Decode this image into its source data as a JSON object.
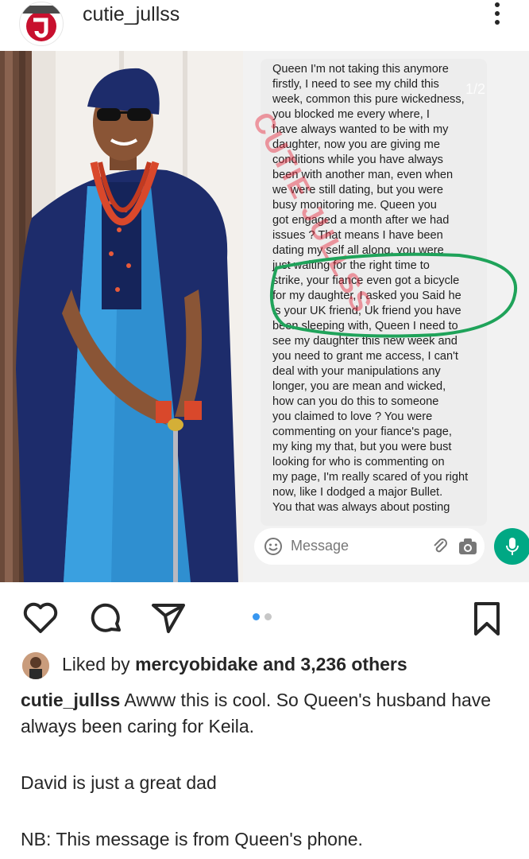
{
  "header": {
    "username": "cutie_jullss",
    "logo_text": "CUTIE_JULLSS"
  },
  "post": {
    "page_indicator": "1/2",
    "watermark": "CUTIE JULLSS",
    "chat_message": "Queen I'm not taking this anymore\nfirstly, I need to see my child this\nweek, common this pure wickedness,\nyou blocked me every where,  I\nhave always wanted to be with my\ndaughter, now you are giving me\nconditions while you have always\nbeen with another man, even when\nwe were still dating,  but you were\nbusy monitoring me. Queen you\ngot engaged a month after we had\nissues ? That means I have been\ndating my self all along,  you were\njust  waiting for the right time to\nstrike, your fiance even got a bicycle\nfor my daughter, I asked you Said he\nis your UK friend, Uk friend you have\nbeen sleeping with, Queen I need to\nsee my daughter this new week and\nyou need to grant me access, I can't\ndeal with your manipulations any\nlonger, you are mean and wicked,\nhow can you do this to someone\nyou claimed to  love ? You were\ncommenting on your fiance's page,\nmy king my that, but you were bust\nlooking for who is commenting on\nmy page, I'm really scared of you right\nnow, like I dodged a major Bullet.\nYou that was always about posting",
    "message_placeholder": "Message",
    "icons": [
      "emoji-icon",
      "attach-icon",
      "camera-icon",
      "mic-icon"
    ],
    "colors": {
      "whatsapp_green": "#00a884",
      "highlight_green": "#1fa35a",
      "agbada_blue": "#2f8fd0",
      "agbada_navy": "#1d2c6b"
    }
  },
  "actions": {
    "icons": [
      "heart-icon",
      "comment-icon",
      "share-icon",
      "bookmark-icon"
    ],
    "carousel": {
      "count": 2,
      "active": 1
    },
    "colors": {
      "active_dot": "#3897f0",
      "inactive_dot": "#c7c7c7"
    }
  },
  "likes": {
    "prefix": "Liked by ",
    "user": "mercyobidake",
    "suffix": " and 3,236 others"
  },
  "caption": {
    "user": "cutie_jullss",
    "line1": " Awww this is cool. So Queen's husband have always been caring for Keila.",
    "line2": "David is just a great dad",
    "line3": "NB: This message is from Queen's phone."
  }
}
